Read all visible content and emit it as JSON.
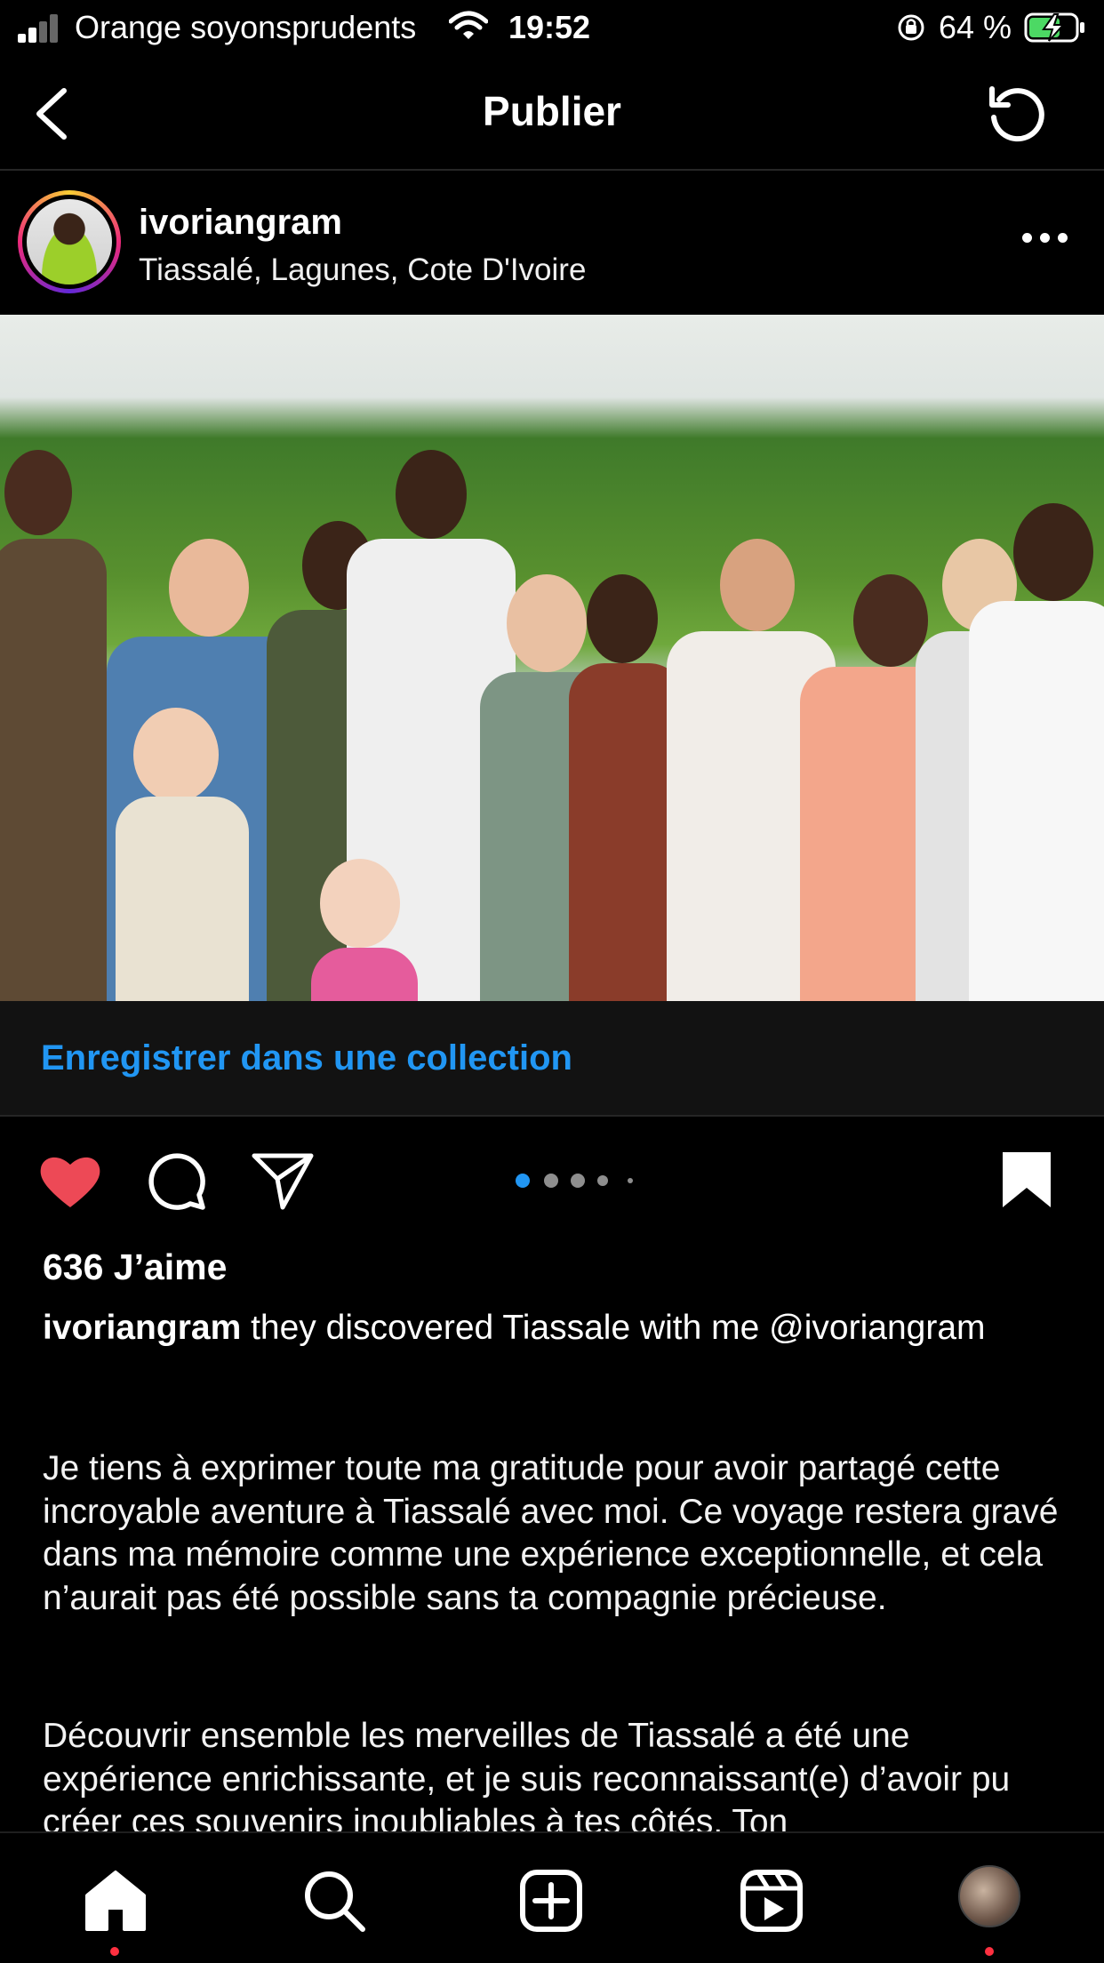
{
  "status_bar": {
    "carrier": "Orange soyonsprudents",
    "time": "19:52",
    "battery": "64 %"
  },
  "header": {
    "title": "Publier"
  },
  "post": {
    "username": "ivoriangram",
    "location": "Tiassalé, Lagunes, Cote D'Ivoire",
    "save_to_collection": "Enregistrer dans une collection",
    "likes": "636 J’aime",
    "carousel": {
      "count": 5,
      "active_index": 0
    },
    "liked": true,
    "saved": true,
    "caption_username": "ivoriangram",
    "caption_text": " they discovered Tiassale with me @ivoriangram",
    "paragraphs": [
      "Je tiens à exprimer toute ma gratitude pour avoir partagé cette incroyable aventure à Tiassalé avec moi. Ce voyage restera gravé dans ma mémoire comme une expérience exceptionnelle, et cela n’aurait pas été possible sans ta compagnie précieuse.",
      "Découvrir ensemble les merveilles de Tiassalé a été une expérience enrichissante, et je suis reconnaissant(e) d’avoir pu créer ces souvenirs inoubliables à tes côtés. Ton"
    ]
  },
  "tab_bar": {
    "items": [
      "home-icon",
      "search-icon",
      "create-icon",
      "reels-icon",
      "profile-avatar"
    ],
    "active": "home-icon"
  },
  "colors": {
    "background": "#000000",
    "link_blue": "#2196f3",
    "like_red": "#ed4956",
    "notification_dot": "#ff3040"
  }
}
